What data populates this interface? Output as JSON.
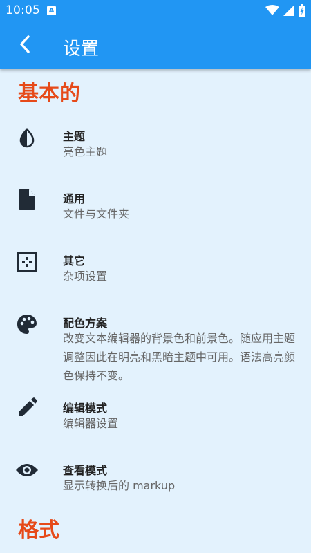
{
  "status_bar": {
    "time": "10:05",
    "notification_icon": "a-badge-icon",
    "icons": [
      "wifi-icon",
      "signal-icon",
      "battery-charging-icon"
    ]
  },
  "app_bar": {
    "title": "设置",
    "back_icon": "chevron-left-icon"
  },
  "sections": [
    {
      "title": "基本的"
    },
    {
      "title": "格式"
    }
  ],
  "items": [
    {
      "icon": "contrast-icon",
      "title": "主题",
      "summary": "亮色主题"
    },
    {
      "icon": "file-icon",
      "title": "通用",
      "summary": "文件与文件夹"
    },
    {
      "icon": "dots-grid-icon",
      "title": "其它",
      "summary": "杂项设置"
    },
    {
      "icon": "palette-icon",
      "title": "配色方案",
      "summary": "改变文本编辑器的背景色和前景色。随应用主题调整因此在明亮和黑暗主题中可用。语法高亮颜色保持不变。"
    },
    {
      "icon": "pencil-icon",
      "title": "编辑模式",
      "summary": "编辑器设置"
    },
    {
      "icon": "eye-icon",
      "title": "查看模式",
      "summary": "显示转换后的 markup"
    }
  ],
  "colors": {
    "app_bar": "#2196f3",
    "background": "#e3f2fd",
    "section_header": "#e64a19",
    "icon": "#212b36"
  }
}
